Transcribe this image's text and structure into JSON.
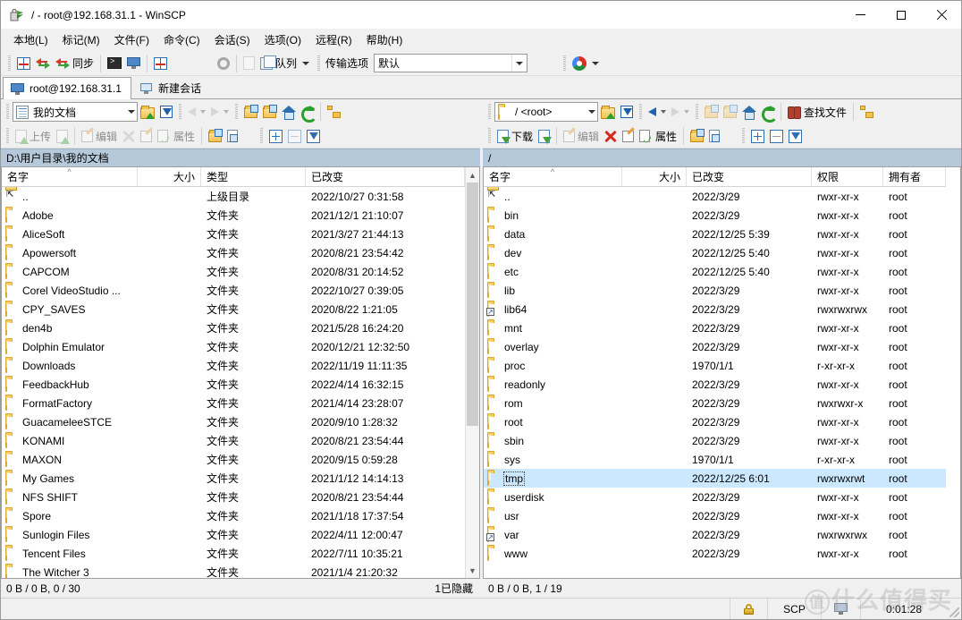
{
  "window": {
    "title": "/ - root@192.168.31.1 - WinSCP",
    "minimize_label": "Minimize",
    "maximize_label": "Maximize",
    "close_label": "Close"
  },
  "menubar": [
    {
      "label": "本地(L)"
    },
    {
      "label": "标记(M)"
    },
    {
      "label": "文件(F)"
    },
    {
      "label": "命令(C)"
    },
    {
      "label": "会话(S)"
    },
    {
      "label": "选项(O)"
    },
    {
      "label": "远程(R)"
    },
    {
      "label": "帮助(H)"
    }
  ],
  "toolbar": {
    "sync_label": "同步",
    "queue_label": "队列",
    "transfer_options_label": "传输选项",
    "transfer_options_value": "默认"
  },
  "tabs": [
    {
      "label": "root@192.168.31.1",
      "icon": "monitor-icon",
      "active": true
    },
    {
      "label": "新建会话",
      "icon": "new-session-icon",
      "active": false
    }
  ],
  "left_pane": {
    "path_combo_value": "我的文档",
    "address": "D:\\用户目录\\我的文档",
    "toolbar2": {
      "upload_label": "上传",
      "edit_label": "编辑",
      "properties_label": "属性"
    },
    "columns": [
      {
        "label": "名字",
        "align": "left",
        "sorted": true
      },
      {
        "label": "大小",
        "align": "right"
      },
      {
        "label": "类型",
        "align": "left"
      },
      {
        "label": "已改变",
        "align": "left"
      }
    ],
    "rows": [
      {
        "name": "..",
        "icon": "updir-icon",
        "size": "",
        "type": "上级目录",
        "modified": "2022/10/27  0:31:58"
      },
      {
        "name": "Adobe",
        "icon": "folder-icon",
        "size": "",
        "type": "文件夹",
        "modified": "2021/12/1  21:10:07"
      },
      {
        "name": "AliceSoft",
        "icon": "folder-icon",
        "size": "",
        "type": "文件夹",
        "modified": "2021/3/27  21:44:13"
      },
      {
        "name": "Apowersoft",
        "icon": "folder-icon",
        "size": "",
        "type": "文件夹",
        "modified": "2020/8/21  23:54:42"
      },
      {
        "name": "CAPCOM",
        "icon": "folder-icon",
        "size": "",
        "type": "文件夹",
        "modified": "2020/8/31  20:14:52"
      },
      {
        "name": "Corel VideoStudio ...",
        "icon": "folder-icon",
        "size": "",
        "type": "文件夹",
        "modified": "2022/10/27  0:39:05"
      },
      {
        "name": "CPY_SAVES",
        "icon": "folder-icon",
        "size": "",
        "type": "文件夹",
        "modified": "2020/8/22  1:21:05"
      },
      {
        "name": "den4b",
        "icon": "folder-icon",
        "size": "",
        "type": "文件夹",
        "modified": "2021/5/28  16:24:20"
      },
      {
        "name": "Dolphin Emulator",
        "icon": "folder-icon",
        "size": "",
        "type": "文件夹",
        "modified": "2020/12/21  12:32:50"
      },
      {
        "name": "Downloads",
        "icon": "folder-icon",
        "size": "",
        "type": "文件夹",
        "modified": "2022/11/19  11:11:35"
      },
      {
        "name": "FeedbackHub",
        "icon": "folder-icon",
        "size": "",
        "type": "文件夹",
        "modified": "2022/4/14  16:32:15"
      },
      {
        "name": "FormatFactory",
        "icon": "folder-icon",
        "size": "",
        "type": "文件夹",
        "modified": "2021/4/14  23:28:07"
      },
      {
        "name": "GuacameleeSTCE",
        "icon": "folder-icon",
        "size": "",
        "type": "文件夹",
        "modified": "2020/9/10  1:28:32"
      },
      {
        "name": "KONAMI",
        "icon": "folder-icon",
        "size": "",
        "type": "文件夹",
        "modified": "2020/8/21  23:54:44"
      },
      {
        "name": "MAXON",
        "icon": "folder-icon",
        "size": "",
        "type": "文件夹",
        "modified": "2020/9/15  0:59:28"
      },
      {
        "name": "My Games",
        "icon": "folder-icon",
        "size": "",
        "type": "文件夹",
        "modified": "2021/1/12  14:14:13"
      },
      {
        "name": "NFS SHIFT",
        "icon": "folder-icon",
        "size": "",
        "type": "文件夹",
        "modified": "2020/8/21  23:54:44"
      },
      {
        "name": "Spore",
        "icon": "folder-icon",
        "size": "",
        "type": "文件夹",
        "modified": "2021/1/18  17:37:54"
      },
      {
        "name": "Sunlogin Files",
        "icon": "folder-icon",
        "size": "",
        "type": "文件夹",
        "modified": "2022/4/11  12:00:47"
      },
      {
        "name": "Tencent Files",
        "icon": "folder-icon",
        "size": "",
        "type": "文件夹",
        "modified": "2022/7/11  10:35:21"
      },
      {
        "name": "The Witcher 3",
        "icon": "folder-icon",
        "size": "",
        "type": "文件夹",
        "modified": "2021/1/4  21:20:32"
      }
    ],
    "status_left": "0 B / 0 B,  0 / 30",
    "status_right": "1已隐藏"
  },
  "right_pane": {
    "path_combo_value": "/ <root>",
    "address": "/",
    "find_files_label": "查找文件",
    "toolbar2": {
      "download_label": "下载",
      "edit_label": "编辑",
      "properties_label": "属性"
    },
    "columns": [
      {
        "label": "名字",
        "align": "left",
        "sorted": true
      },
      {
        "label": "大小",
        "align": "right"
      },
      {
        "label": "已改变",
        "align": "left"
      },
      {
        "label": "权限",
        "align": "left"
      },
      {
        "label": "拥有者",
        "align": "left"
      }
    ],
    "rows": [
      {
        "name": "..",
        "icon": "updir-icon",
        "size": "",
        "modified": "2022/3/29",
        "rights": "rwxr-xr-x",
        "owner": "root",
        "selected": false
      },
      {
        "name": "bin",
        "icon": "folder-icon",
        "size": "",
        "modified": "2022/3/29",
        "rights": "rwxr-xr-x",
        "owner": "root",
        "selected": false
      },
      {
        "name": "data",
        "icon": "folder-icon",
        "size": "",
        "modified": "2022/12/25 5:39",
        "rights": "rwxr-xr-x",
        "owner": "root",
        "selected": false
      },
      {
        "name": "dev",
        "icon": "folder-icon",
        "size": "",
        "modified": "2022/12/25 5:40",
        "rights": "rwxr-xr-x",
        "owner": "root",
        "selected": false
      },
      {
        "name": "etc",
        "icon": "folder-icon",
        "size": "",
        "modified": "2022/12/25 5:40",
        "rights": "rwxr-xr-x",
        "owner": "root",
        "selected": false
      },
      {
        "name": "lib",
        "icon": "folder-icon",
        "size": "",
        "modified": "2022/3/29",
        "rights": "rwxr-xr-x",
        "owner": "root",
        "selected": false
      },
      {
        "name": "lib64",
        "icon": "symlink-icon",
        "size": "",
        "modified": "2022/3/29",
        "rights": "rwxrwxrwx",
        "owner": "root",
        "selected": false
      },
      {
        "name": "mnt",
        "icon": "folder-icon",
        "size": "",
        "modified": "2022/3/29",
        "rights": "rwxr-xr-x",
        "owner": "root",
        "selected": false
      },
      {
        "name": "overlay",
        "icon": "folder-icon",
        "size": "",
        "modified": "2022/3/29",
        "rights": "rwxr-xr-x",
        "owner": "root",
        "selected": false
      },
      {
        "name": "proc",
        "icon": "folder-icon",
        "size": "",
        "modified": "1970/1/1",
        "rights": "r-xr-xr-x",
        "owner": "root",
        "selected": false
      },
      {
        "name": "readonly",
        "icon": "folder-icon",
        "size": "",
        "modified": "2022/3/29",
        "rights": "rwxr-xr-x",
        "owner": "root",
        "selected": false
      },
      {
        "name": "rom",
        "icon": "folder-icon",
        "size": "",
        "modified": "2022/3/29",
        "rights": "rwxrwxr-x",
        "owner": "root",
        "selected": false
      },
      {
        "name": "root",
        "icon": "folder-icon",
        "size": "",
        "modified": "2022/3/29",
        "rights": "rwxr-xr-x",
        "owner": "root",
        "selected": false
      },
      {
        "name": "sbin",
        "icon": "folder-icon",
        "size": "",
        "modified": "2022/3/29",
        "rights": "rwxr-xr-x",
        "owner": "root",
        "selected": false
      },
      {
        "name": "sys",
        "icon": "folder-icon",
        "size": "",
        "modified": "1970/1/1",
        "rights": "r-xr-xr-x",
        "owner": "root",
        "selected": false
      },
      {
        "name": "tmp",
        "icon": "folder-icon",
        "size": "",
        "modified": "2022/12/25 6:01",
        "rights": "rwxrwxrwt",
        "owner": "root",
        "selected": true
      },
      {
        "name": "userdisk",
        "icon": "folder-icon",
        "size": "",
        "modified": "2022/3/29",
        "rights": "rwxr-xr-x",
        "owner": "root",
        "selected": false
      },
      {
        "name": "usr",
        "icon": "folder-icon",
        "size": "",
        "modified": "2022/3/29",
        "rights": "rwxr-xr-x",
        "owner": "root",
        "selected": false
      },
      {
        "name": "var",
        "icon": "symlink-icon",
        "size": "",
        "modified": "2022/3/29",
        "rights": "rwxrwxrwx",
        "owner": "root",
        "selected": false
      },
      {
        "name": "www",
        "icon": "folder-icon",
        "size": "",
        "modified": "2022/3/29",
        "rights": "rwxr-xr-x",
        "owner": "root",
        "selected": false
      }
    ],
    "status_left": "0 B / 0 B,  1 / 19"
  },
  "statusbar": {
    "protocol": "SCP",
    "elapsed": "0:01:28",
    "lock_icon": "lock-icon",
    "session_icon": "session-icon"
  },
  "watermark": {
    "badge": "值",
    "text": "什么值得买"
  },
  "colors": {
    "selection": "#cce8ff",
    "address_bar": "#b6c9da",
    "chrome": "#f0f0f0",
    "folder": "#f8d775",
    "accent_blue": "#2f6fb0"
  }
}
